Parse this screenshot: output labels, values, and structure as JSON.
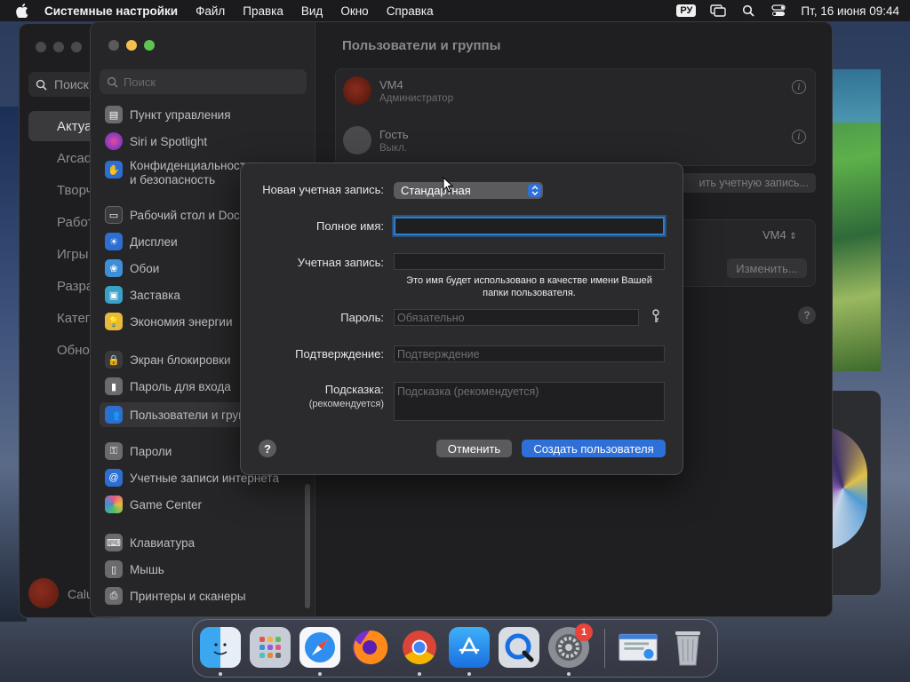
{
  "menubar": {
    "app_name": "Системные настройки",
    "items": [
      "Файл",
      "Правка",
      "Вид",
      "Окно",
      "Справка"
    ],
    "keyboard_layout": "РУ",
    "clock": "Пт, 16 июня  09:44"
  },
  "back_window": {
    "search_placeholder": "Поиск",
    "items": [
      "Актуа",
      "Arcade",
      "Творч",
      "Работ",
      "Игры",
      "Разра",
      "Катег",
      "Обно"
    ],
    "user": "Calu"
  },
  "sidebar": {
    "search_placeholder": "Поиск",
    "items": [
      {
        "label": "Пункт управления",
        "icon": "control-center-icon",
        "color": "#6b6b6e"
      },
      {
        "label": "Siri и Spotlight",
        "icon": "siri-icon",
        "color": "#8a3fb0"
      },
      {
        "label": "Конфиденциальность и безопасность",
        "icon": "hand-icon",
        "color": "#2d6fd1"
      },
      {
        "label": "Рабочий стол и Dock",
        "icon": "desktop-icon",
        "color": "#3a3a3c"
      },
      {
        "label": "Дисплеи",
        "icon": "display-icon",
        "color": "#2d6fd1"
      },
      {
        "label": "Обои",
        "icon": "wallpaper-icon",
        "color": "#3f8fd8"
      },
      {
        "label": "Заставка",
        "icon": "screensaver-icon",
        "color": "#3aa0c8"
      },
      {
        "label": "Экономия энергии",
        "icon": "energy-icon",
        "color": "#e8b93a"
      },
      {
        "label": "Экран блокировки",
        "icon": "lock-icon",
        "color": "#3a3a3c"
      },
      {
        "label": "Пароль для входа",
        "icon": "login-password-icon",
        "color": "#6b6b6e"
      },
      {
        "label": "Пользователи и группы",
        "icon": "users-icon",
        "color": "#2d6fd1"
      },
      {
        "label": "Пароли",
        "icon": "key-icon",
        "color": "#6b6b6e"
      },
      {
        "label": "Учетные записи интернета",
        "icon": "at-icon",
        "color": "#2d6fd1"
      },
      {
        "label": "Game Center",
        "icon": "game-center-icon",
        "color": "#e05a8a"
      },
      {
        "label": "Клавиатура",
        "icon": "keyboard-icon",
        "color": "#6b6b6e"
      },
      {
        "label": "Мышь",
        "icon": "mouse-icon",
        "color": "#6b6b6e"
      },
      {
        "label": "Принтеры и сканеры",
        "icon": "printer-icon",
        "color": "#6b6b6e"
      }
    ]
  },
  "content": {
    "title": "Пользователи и группы",
    "users": [
      {
        "name": "VM4",
        "role": "Администратор"
      },
      {
        "name": "Гость",
        "role": "Выкл."
      }
    ],
    "add_account_button": "ить учетную запись...",
    "auto_login_value": "VM4",
    "edit_button": "Изменить..."
  },
  "dialog": {
    "new_account_label": "Новая учетная запись:",
    "account_type": "Стандартная",
    "full_name_label": "Полное имя:",
    "full_name_value": "",
    "account_name_label": "Учетная запись:",
    "account_name_value": "",
    "account_name_hint": "Это имя будет использовано в качестве имени Вашей папки пользователя.",
    "password_label": "Пароль:",
    "password_placeholder": "Обязательно",
    "confirm_label": "Подтверждение:",
    "confirm_placeholder": "Подтверждение",
    "hint_label": "Подсказка:",
    "hint_label_sub": "(рекомендуется)",
    "hint_placeholder": "Подсказка (рекомендуется)",
    "cancel_button": "Отменить",
    "create_button": "Создать пользователя",
    "help": "?"
  },
  "dock": {
    "apps": [
      "Finder",
      "Launchpad",
      "Safari",
      "Firefox",
      "Chrome",
      "App Store",
      "QuickTime Player",
      "Системные настройки"
    ],
    "settings_badge": "1"
  },
  "colors": {
    "accent": "#2f6fd8",
    "focus_ring": "#2f7fcf",
    "badge": "#e8443a"
  }
}
